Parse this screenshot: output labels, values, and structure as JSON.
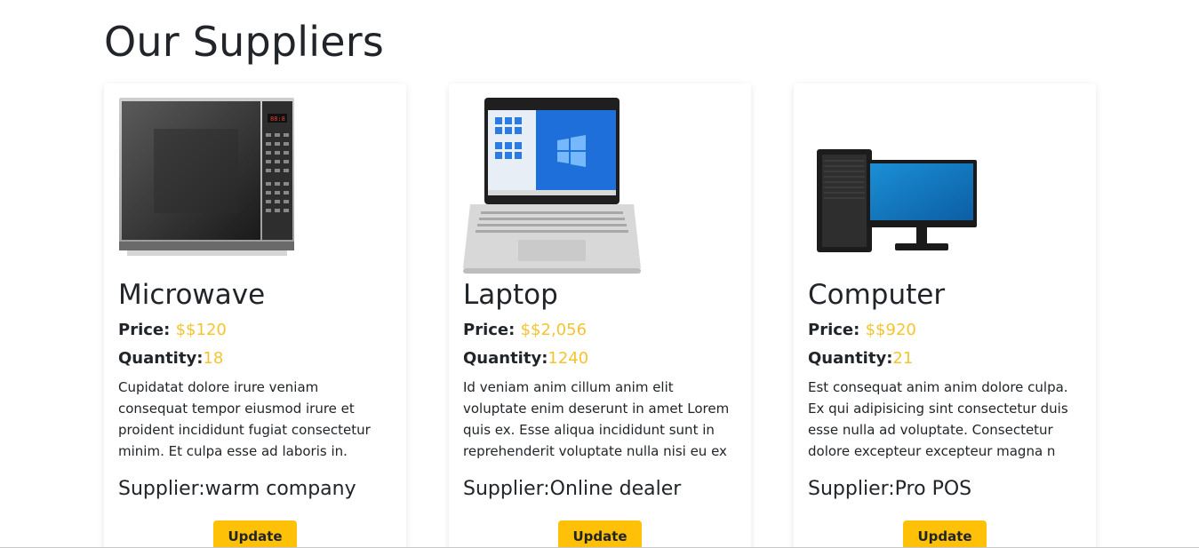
{
  "page": {
    "title": "Our Suppliers"
  },
  "colors": {
    "accent": "#f4c430",
    "button": "#ffc107",
    "text": "#212529"
  },
  "labels": {
    "price": "Price: ",
    "quantity": "Quantity:",
    "supplier": "Supplier:",
    "update": "Update"
  },
  "products": [
    {
      "name": "Microwave",
      "image_icon": "microwave-image",
      "price": "$$120",
      "quantity": "18",
      "description": "Cupidatat dolore irure veniam consequat tempor eiusmod irure et proident incididunt fugiat consectetur minim. Et culpa esse ad laboris in. Ipsum anim",
      "supplier": "warm company"
    },
    {
      "name": "Laptop",
      "image_icon": "laptop-image",
      "price": "$$2,056",
      "quantity": "1240",
      "description": "Id veniam anim cillum anim elit voluptate enim deserunt in amet Lorem quis ex. Esse aliqua incididunt sunt in reprehenderit voluptate nulla nisi eu ex",
      "supplier": "Online dealer"
    },
    {
      "name": "Computer",
      "image_icon": "desktop-computer-image",
      "price": "$$920",
      "quantity": "21",
      "description": "Est consequat anim anim dolore culpa. Ex qui adipisicing sint consectetur duis esse nulla ad voluptate. Consectetur dolore excepteur excepteur magna n",
      "supplier": "Pro POS"
    }
  ]
}
